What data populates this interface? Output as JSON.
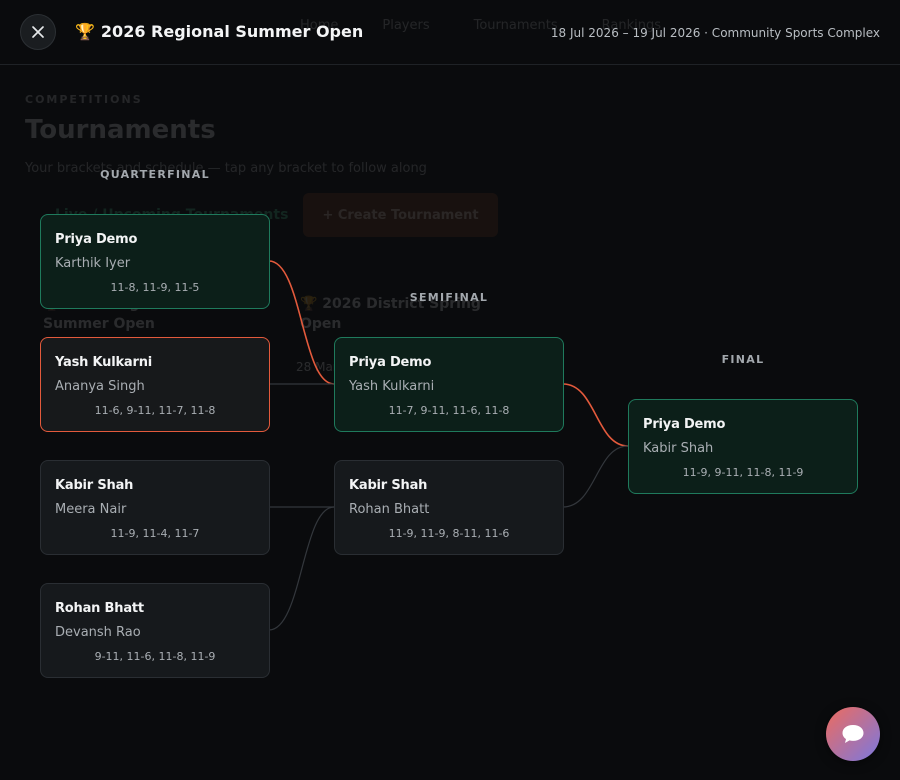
{
  "background_page": {
    "nav": [
      "Home",
      "Players",
      "Tournaments",
      "Rankings"
    ],
    "eyebrow": "COMPETITIONS",
    "title": "Tournaments",
    "subtitle": "Your brackets and schedule — tap any bracket to follow along",
    "create_button": "+ Create Tournament",
    "section_heading": "Live / Upcoming Tournaments",
    "card_1": "🏆 2026 Regional Summer Open",
    "card_2": "🏆 2026 District Spring Open",
    "card_2_date": "28 Mar"
  },
  "modal": {
    "trophy": "🏆",
    "title": "2026 Regional Summer Open",
    "meta": "18 Jul 2026 – 19 Jul 2026 · Community Sports Complex"
  },
  "rounds": {
    "quarterfinal": "QUARTERFINAL",
    "semifinal": "SEMIFINAL",
    "final": "FINAL"
  },
  "matches": {
    "qf1": {
      "winner": "Priya Demo",
      "loser": "Karthik Iyer",
      "score": "11-8, 11-9, 11-5"
    },
    "qf2": {
      "winner": "Yash Kulkarni",
      "loser": "Ananya Singh",
      "score": "11-6, 9-11, 11-7, 11-8"
    },
    "qf3": {
      "winner": "Kabir Shah",
      "loser": "Meera Nair",
      "score": "11-9, 11-4, 11-7"
    },
    "qf4": {
      "winner": "Rohan Bhatt",
      "loser": "Devansh Rao",
      "score": "9-11, 11-6, 11-8, 11-9"
    },
    "sf1": {
      "winner": "Priya Demo",
      "loser": "Yash Kulkarni",
      "score": "11-7, 9-11, 11-6, 11-8"
    },
    "sf2": {
      "winner": "Kabir Shah",
      "loser": "Rohan Bhatt",
      "score": "11-9, 11-9, 8-11, 11-6"
    },
    "final": {
      "winner": "Priya Demo",
      "loser": "Kabir Shah",
      "score": "11-9, 9-11, 11-8, 11-9"
    }
  },
  "colors": {
    "accent_path": "#e35a3c",
    "winner_card_border": "#1f7a5c",
    "connector": "#33373c"
  },
  "icons": {
    "close": "close-icon",
    "chat": "chat-bubble-icon"
  }
}
